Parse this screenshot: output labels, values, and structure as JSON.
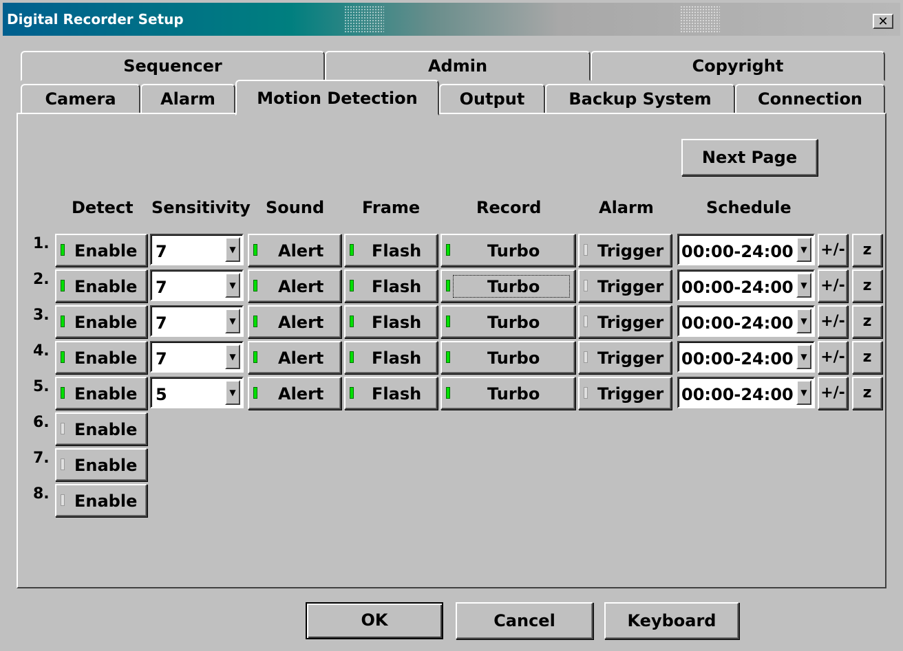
{
  "window": {
    "title": "Digital Recorder Setup",
    "close_glyph": "✕"
  },
  "tabs_back": [
    "Sequencer",
    "Admin",
    "Copyright"
  ],
  "tabs_front": [
    "Camera",
    "Alarm",
    "Motion Detection",
    "Output",
    "Backup System",
    "Connection"
  ],
  "active_tab": "Motion Detection",
  "next_page_label": "Next Page",
  "columns": {
    "detect": "Detect",
    "sensitivity": "Sensitivity",
    "sound": "Sound",
    "frame": "Frame",
    "record": "Record",
    "alarm": "Alarm",
    "schedule": "Schedule"
  },
  "rows": [
    {
      "num": "1.",
      "detect": "Enable",
      "detect_on": true,
      "sensitivity": "7",
      "sound": "Alert",
      "frame": "Flash",
      "record": "Turbo",
      "alarm": "Trigger",
      "schedule": "00:00-24:00",
      "plusminus": "+/-",
      "z": "z"
    },
    {
      "num": "2.",
      "detect": "Enable",
      "detect_on": true,
      "sensitivity": "7",
      "sound": "Alert",
      "frame": "Flash",
      "record": "Turbo",
      "alarm": "Trigger",
      "schedule": "00:00-24:00",
      "plusminus": "+/-",
      "z": "z"
    },
    {
      "num": "3.",
      "detect": "Enable",
      "detect_on": true,
      "sensitivity": "7",
      "sound": "Alert",
      "frame": "Flash",
      "record": "Turbo",
      "alarm": "Trigger",
      "schedule": "00:00-24:00",
      "plusminus": "+/-",
      "z": "z"
    },
    {
      "num": "4.",
      "detect": "Enable",
      "detect_on": true,
      "sensitivity": "7",
      "sound": "Alert",
      "frame": "Flash",
      "record": "Turbo",
      "alarm": "Trigger",
      "schedule": "00:00-24:00",
      "plusminus": "+/-",
      "z": "z"
    },
    {
      "num": "5.",
      "detect": "Enable",
      "detect_on": true,
      "sensitivity": "5",
      "sound": "Alert",
      "frame": "Flash",
      "record": "Turbo",
      "alarm": "Trigger",
      "schedule": "00:00-24:00",
      "plusminus": "+/-",
      "z": "z"
    },
    {
      "num": "6.",
      "detect": "Enable",
      "detect_on": false
    },
    {
      "num": "7.",
      "detect": "Enable",
      "detect_on": false
    },
    {
      "num": "8.",
      "detect": "Enable",
      "detect_on": false
    }
  ],
  "indicator_colors": {
    "on": "#00e000",
    "off": "#e0e0e0"
  },
  "footer": {
    "ok": "OK",
    "cancel": "Cancel",
    "keyboard": "Keyboard"
  }
}
